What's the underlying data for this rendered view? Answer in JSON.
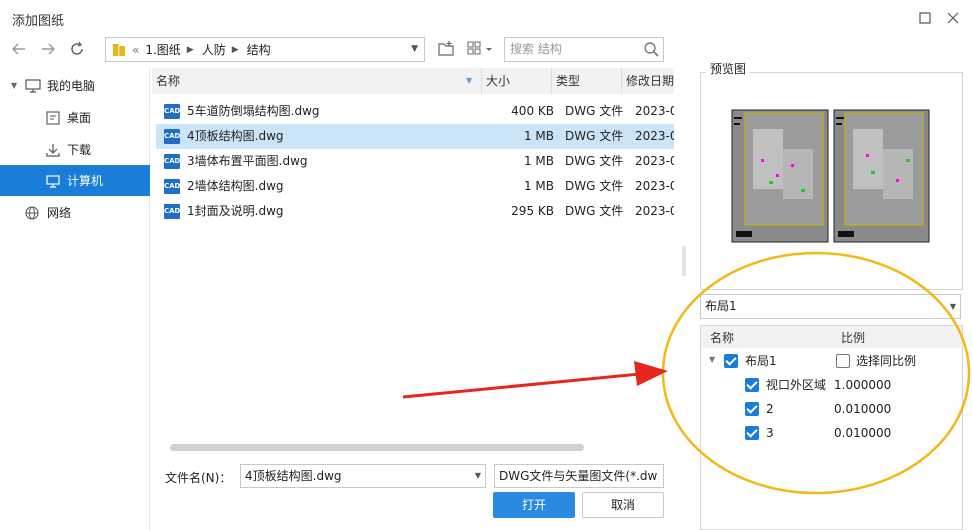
{
  "window": {
    "title": "添加图纸"
  },
  "toolbar": {
    "address_segments": [
      "1.图纸",
      "人防",
      "结构"
    ],
    "search_placeholder": "搜索 结构"
  },
  "sidebar": {
    "items": [
      {
        "label": "我的电脑",
        "icon": "computer-icon"
      },
      {
        "label": "桌面",
        "icon": "desktop-icon"
      },
      {
        "label": "下载",
        "icon": "download-icon"
      },
      {
        "label": "计算机",
        "icon": "monitor-icon",
        "selected": true
      },
      {
        "label": "网络",
        "icon": "globe-icon"
      }
    ]
  },
  "filelist": {
    "columns": [
      "名称",
      "大小",
      "类型",
      "修改日期"
    ],
    "rows": [
      {
        "name": "5车道防倒塌结构图.dwg",
        "size": "400 KB",
        "type": "DWG 文件",
        "date": "2023-0",
        "icon_label": "CAD"
      },
      {
        "name": "4顶板结构图.dwg",
        "size": "1 MB",
        "type": "DWG 文件",
        "date": "2023-0",
        "icon_label": "CAD",
        "selected": true
      },
      {
        "name": "3墙体布置平面图.dwg",
        "size": "1 MB",
        "type": "DWG 文件",
        "date": "2023-0",
        "icon_label": "CAD"
      },
      {
        "name": "2墙体结构图.dwg",
        "size": "1 MB",
        "type": "DWG 文件",
        "date": "2023-0",
        "icon_label": "CAD"
      },
      {
        "name": "1封面及说明.dwg",
        "size": "295 KB",
        "type": "DWG 文件",
        "date": "2023-0",
        "icon_label": "CAD"
      }
    ]
  },
  "bottom": {
    "filename_label": "文件名(N)：",
    "filename_value": "4顶板结构图.dwg",
    "filetype": "DWG文件与矢量图文件(*.dw",
    "open_label": "打开",
    "cancel_label": "取消"
  },
  "preview": {
    "label": "预览图",
    "layout_selected": "布局1",
    "tree_headers": [
      "名称",
      "比例"
    ],
    "tree": {
      "root": {
        "label": "布局1",
        "checked": true
      },
      "same_scale": {
        "label": "选择同比例",
        "checked": false
      },
      "children": [
        {
          "label": "视口外区域",
          "scale": "1.000000",
          "checked": true
        },
        {
          "label": "2",
          "scale": "0.010000",
          "checked": true
        },
        {
          "label": "3",
          "scale": "0.010000",
          "checked": true
        }
      ]
    }
  },
  "colors": {
    "accent": "#1a7dd7",
    "selection": "#cce4f7",
    "annotation_arrow": "#e8261c",
    "annotation_ellipse": "#f2b817"
  }
}
